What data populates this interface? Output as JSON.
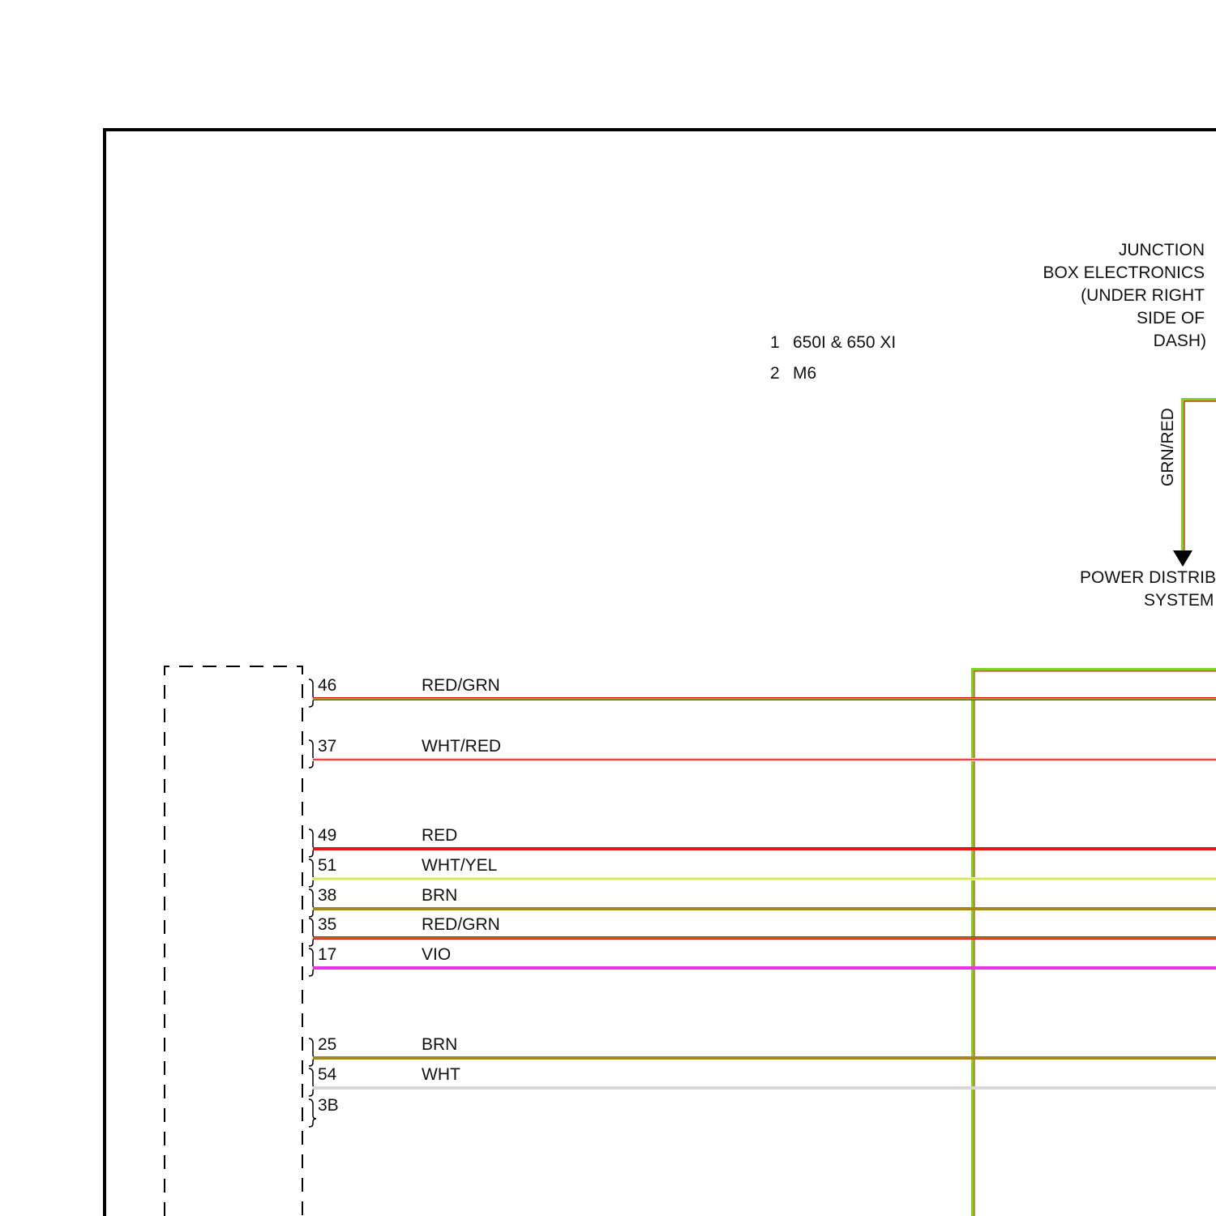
{
  "junction_box": {
    "lines": [
      "JUNCTION",
      "BOX ELECTRONICS",
      "(UNDER RIGHT",
      "SIDE OF",
      "DASH)"
    ]
  },
  "legend": [
    {
      "num": "1",
      "text": "650I & 650 XI"
    },
    {
      "num": "2",
      "text": "M6"
    }
  ],
  "feed_wire": {
    "label": "GRN/RED",
    "colors": [
      "#7fd320",
      "#d41818"
    ]
  },
  "power_distribution": {
    "lines": [
      "POWER DISTRIBUTION",
      "SYSTEM"
    ]
  },
  "connector_pins": [
    {
      "pin": "46",
      "wire": "RED/GRN",
      "colors": [
        "#d41818",
        "#7fd320"
      ]
    },
    {
      "pin": "37",
      "wire": "WHT/RED",
      "colors": [
        "#ffd0d0",
        "#e01818"
      ]
    },
    {
      "pin": "49",
      "wire": "RED",
      "colors": [
        "#e01818"
      ]
    },
    {
      "pin": "51",
      "wire": "WHT/YEL",
      "colors": [
        "#f0f5b0",
        "#c8e63c"
      ]
    },
    {
      "pin": "38",
      "wire": "BRN",
      "colors": [
        "#a8861e"
      ]
    },
    {
      "pin": "35",
      "wire": "RED/GRN",
      "colors": [
        "#d41818",
        "#a8861e"
      ]
    },
    {
      "pin": "17",
      "wire": "VIO",
      "colors": [
        "#e535e5"
      ]
    },
    {
      "pin": "25",
      "wire": "BRN",
      "colors": [
        "#a8861e"
      ]
    },
    {
      "pin": "54",
      "wire": "WHT",
      "colors": [
        "#d8d8d8"
      ]
    },
    {
      "pin": "3B",
      "wire": "",
      "colors": []
    }
  ]
}
